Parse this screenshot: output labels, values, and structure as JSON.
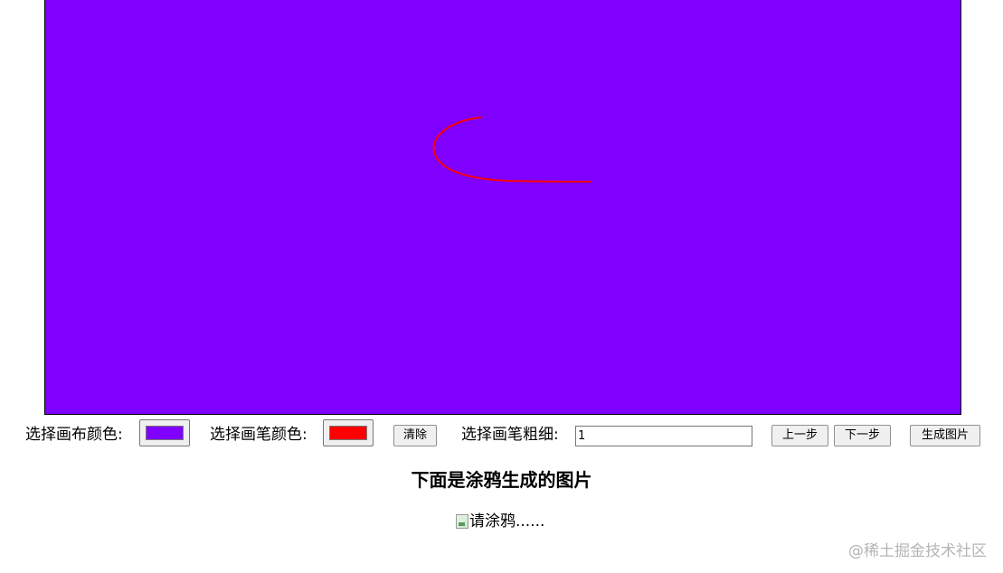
{
  "canvas": {
    "background_color": "#7F00FF",
    "stroke_color": "#FF0000"
  },
  "toolbar": {
    "canvas_color_label": "选择画布颜色:",
    "canvas_color_value": "#7F00FF",
    "pen_color_label": "选择画笔颜色:",
    "pen_color_value": "#FF0000",
    "clear_label": "清除",
    "pen_width_label": "选择画笔粗细:",
    "pen_width_value": "1",
    "undo_label": "上一步",
    "redo_label": "下一步",
    "generate_label": "生成图片"
  },
  "result": {
    "title": "下面是涂鸦生成的图片",
    "image_alt": "请涂鸦......"
  },
  "watermark": "@稀土掘金技术社区"
}
